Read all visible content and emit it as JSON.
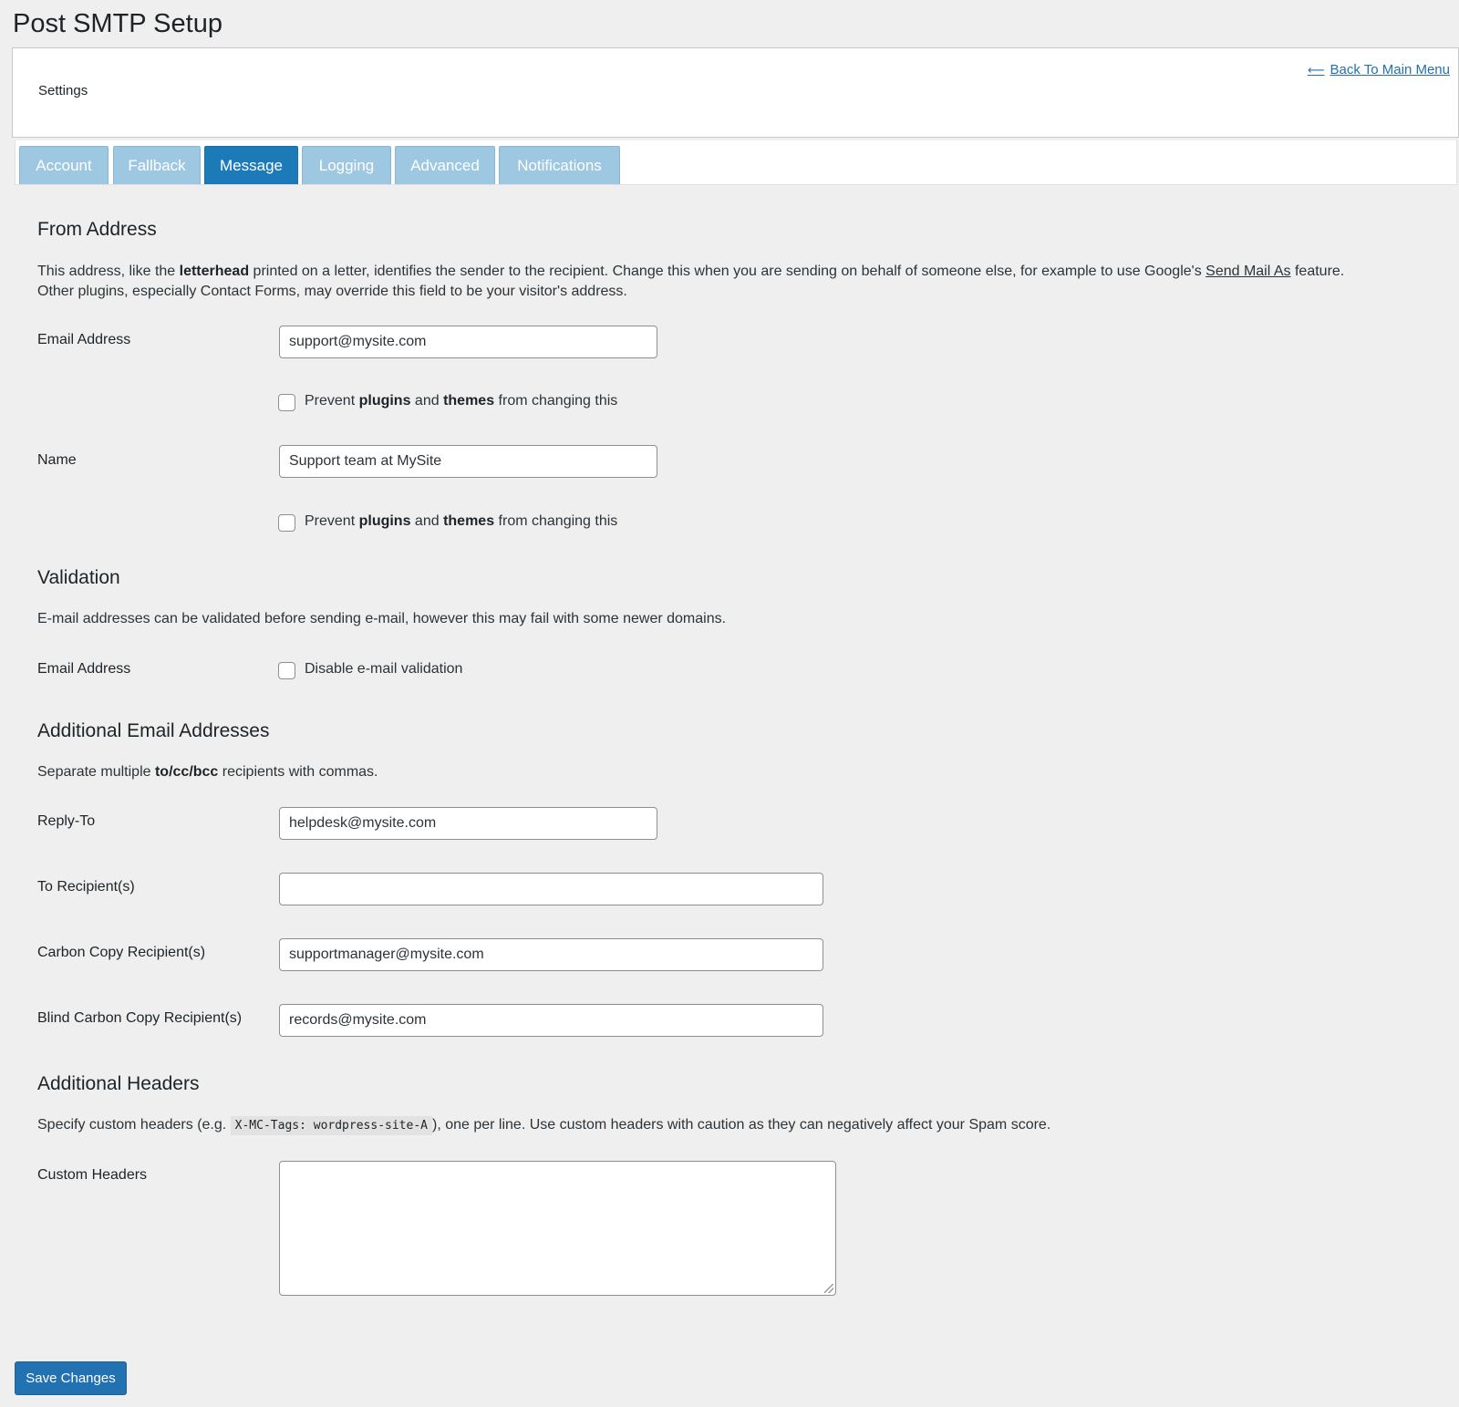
{
  "page": {
    "title": "Post SMTP Setup"
  },
  "header": {
    "settings_label": "Settings",
    "back_link": "Back To Main Menu"
  },
  "tabs": [
    {
      "label": "Account",
      "active": false
    },
    {
      "label": "Fallback",
      "active": false
    },
    {
      "label": "Message",
      "active": true
    },
    {
      "label": "Logging",
      "active": false
    },
    {
      "label": "Advanced",
      "active": false
    },
    {
      "label": "Notifications",
      "active": false
    }
  ],
  "from_address": {
    "heading": "From Address",
    "desc_1": "This address, like the ",
    "desc_bold": "letterhead",
    "desc_2": " printed on a letter, identifies the sender to the recipient. Change this when you are sending on behalf of someone else, for example to use Google's ",
    "desc_link": "Send Mail As",
    "desc_3": " feature.",
    "desc_line2": "Other plugins, especially Contact Forms, may override this field to be your visitor's address.",
    "email_label": "Email Address",
    "email_value": "support@mysite.com",
    "name_label": "Name",
    "name_value": "Support team at MySite",
    "prevent_1": "Prevent ",
    "prevent_plugins": "plugins",
    "prevent_and": " and ",
    "prevent_themes": "themes",
    "prevent_2": " from changing this"
  },
  "validation": {
    "heading": "Validation",
    "desc": "E-mail addresses can be validated before sending e-mail, however this may fail with some newer domains.",
    "email_label": "Email Address",
    "disable_label": "Disable e-mail validation"
  },
  "additional_emails": {
    "heading": "Additional Email Addresses",
    "desc_1": "Separate multiple ",
    "desc_bold": "to/cc/bcc",
    "desc_2": " recipients with commas.",
    "reply_to_label": "Reply-To",
    "reply_to_value": "helpdesk@mysite.com",
    "to_label": "To Recipient(s)",
    "to_value": "",
    "cc_label": "Carbon Copy Recipient(s)",
    "cc_value": "supportmanager@mysite.com",
    "bcc_label": "Blind Carbon Copy Recipient(s)",
    "bcc_value": "records@mysite.com"
  },
  "additional_headers": {
    "heading": "Additional Headers",
    "desc_1": "Specify custom headers (e.g. ",
    "desc_code": "X-MC-Tags: wordpress-site-A",
    "desc_2": "), one per line. Use custom headers with caution as they can negatively affect your Spam score.",
    "custom_label": "Custom Headers",
    "custom_value": ""
  },
  "save_button": "Save Changes",
  "colors": {
    "tab_inactive": "#9ec7e2",
    "tab_active": "#1d7ab8",
    "button_primary": "#2271b1",
    "link": "#2271b1"
  },
  "icons": {
    "back": "arrow-left-icon"
  }
}
